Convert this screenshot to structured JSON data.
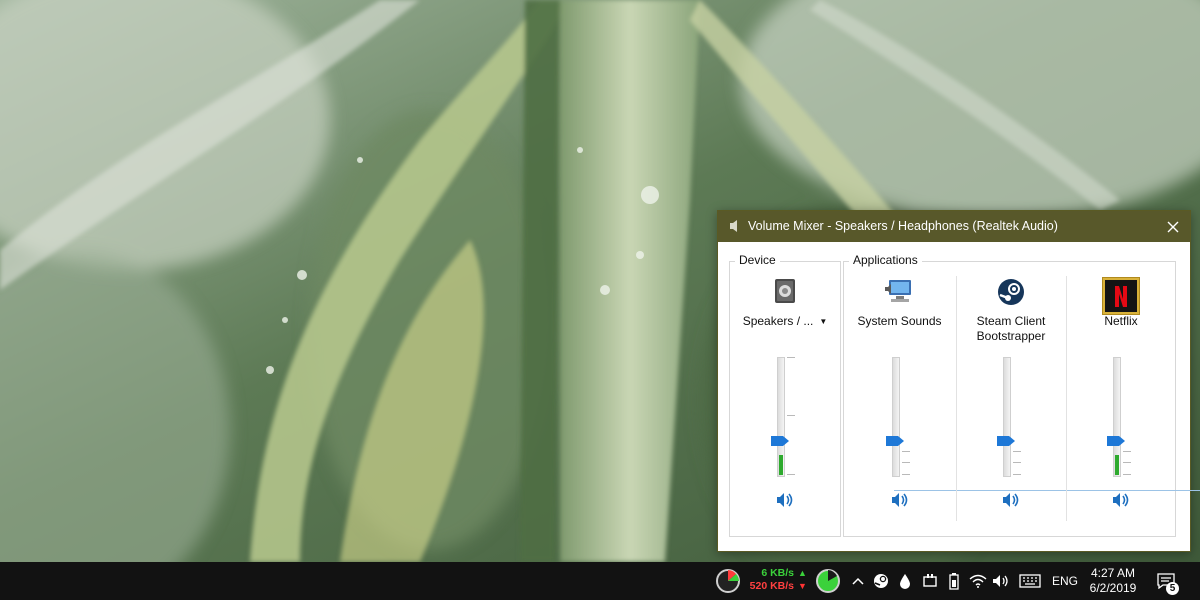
{
  "mixer": {
    "title": "Volume Mixer - Speakers / Headphones (Realtek Audio)",
    "device_group_label": "Device",
    "applications_group_label": "Applications",
    "device": {
      "name": "Speakers / ...",
      "level": 0.3
    },
    "applications": [
      {
        "name": "System Sounds",
        "icon": "system-sounds-icon",
        "level": 0.3
      },
      {
        "name": "Steam Client",
        "name2": "Bootstrapper",
        "icon": "steam-icon",
        "level": 0.3
      },
      {
        "name": "Netflix",
        "icon": "netflix-icon",
        "level": 0.3
      }
    ],
    "accent_color": "#1e78d7",
    "titlebar_color": "#58582a"
  },
  "taskbar": {
    "upload_speed": "6 KB/s",
    "download_speed": "520 KB/s",
    "language": "ENG",
    "time": "4:27 AM",
    "date": "6/2/2019",
    "notification_count": "5"
  }
}
